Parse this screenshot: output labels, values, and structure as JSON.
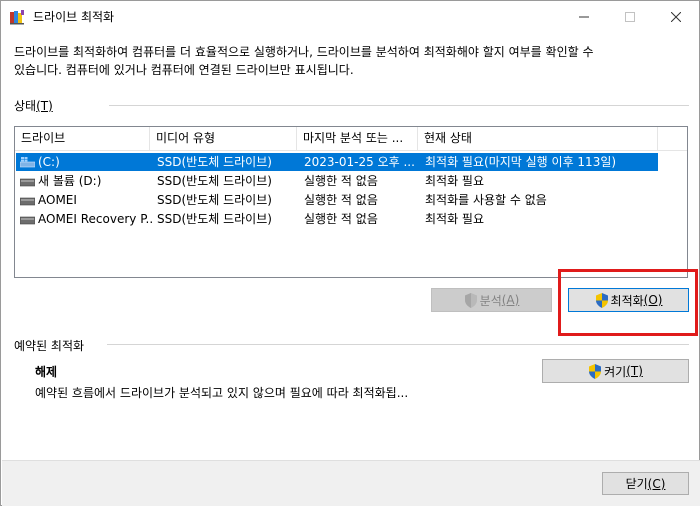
{
  "window": {
    "title": "드라이브 최적화"
  },
  "description": {
    "line1": "드라이브를 최적화하여 컴퓨터를 더 효율적으로 실행하거나, 드라이브를 분석하여 최적화해야 할지 여부를 확인할 수",
    "line2": "있습니다. 컴퓨터에 있거나 컴퓨터에 연결된 드라이브만 표시됩니다."
  },
  "status_section": {
    "label": "상태",
    "mnemonic": "(T)"
  },
  "table": {
    "columns": [
      "드라이브",
      "미디어 유형",
      "마지막 분석 또는 ...",
      "현재 상태"
    ],
    "rows": [
      {
        "drive": "(C:)",
        "media": "SSD(반도체 드라이브)",
        "last": "2023-01-25 오후 ...",
        "status": "최적화 필요(마지막 실행 이후 113일)",
        "icon": "windows-drive-icon",
        "selected": true
      },
      {
        "drive": "새 볼륨 (D:)",
        "media": "SSD(반도체 드라이브)",
        "last": "실행한 적 없음",
        "status": "최적화 필요",
        "icon": "drive-icon",
        "selected": false
      },
      {
        "drive": "AOMEI",
        "media": "SSD(반도체 드라이브)",
        "last": "실행한 적 없음",
        "status": "최적화를 사용할 수 없음",
        "icon": "drive-icon",
        "selected": false
      },
      {
        "drive": "AOMEI Recovery P...",
        "media": "SSD(반도체 드라이브)",
        "last": "실행한 적 없음",
        "status": "최적화 필요",
        "icon": "drive-icon",
        "selected": false
      }
    ]
  },
  "buttons": {
    "analyze": {
      "label": "분석",
      "mnemonic": "(A)",
      "enabled": false
    },
    "optimize": {
      "label": "최적화",
      "mnemonic": "(O)",
      "enabled": true
    },
    "turn_on": {
      "label": "켜기",
      "mnemonic": "(T)",
      "enabled": true
    },
    "close": {
      "label": "닫기",
      "mnemonic": "(C)",
      "enabled": true
    }
  },
  "scheduled_section": {
    "label": "예약된 최적화",
    "state": "해제",
    "description": "예약된 흐름에서 드라이브가 분석되고 있지 않으며 필요에 따라 최적화됩...",
    "mnemonic_char": "T"
  },
  "colors": {
    "selection": "#0078d7",
    "highlight_box": "#e01b1b"
  }
}
